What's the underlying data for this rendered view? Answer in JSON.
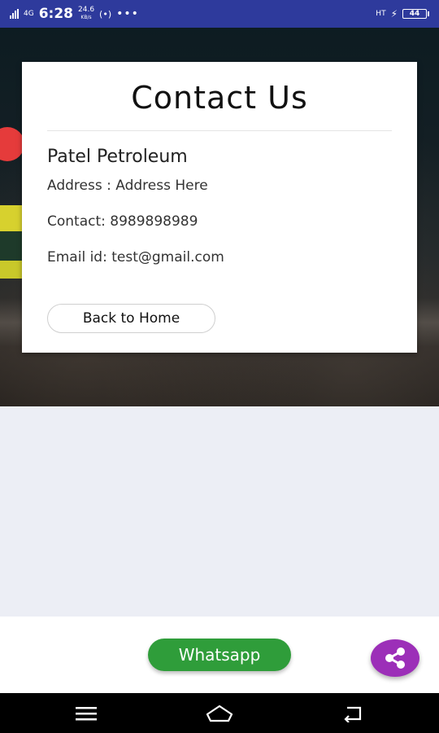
{
  "status_bar": {
    "network_left": "4G",
    "time": "6:28",
    "speed": "24.6",
    "speed_unit": "KB/s",
    "dots": "•••",
    "network_right": "HT",
    "battery": "44"
  },
  "card": {
    "title": "Contact Us",
    "company": "Patel Petroleum",
    "address": "Address : Address Here",
    "contact": "Contact: 8989898989",
    "email": "Email id: test@gmail.com",
    "back_button": "Back to Home"
  },
  "bottom": {
    "whatsapp_label": "Whatsapp"
  },
  "colors": {
    "status_bar": "#2e3a9c",
    "whatsapp": "#2f9d3a",
    "share": "#9c2fb8",
    "content_bg": "#eceef5"
  }
}
